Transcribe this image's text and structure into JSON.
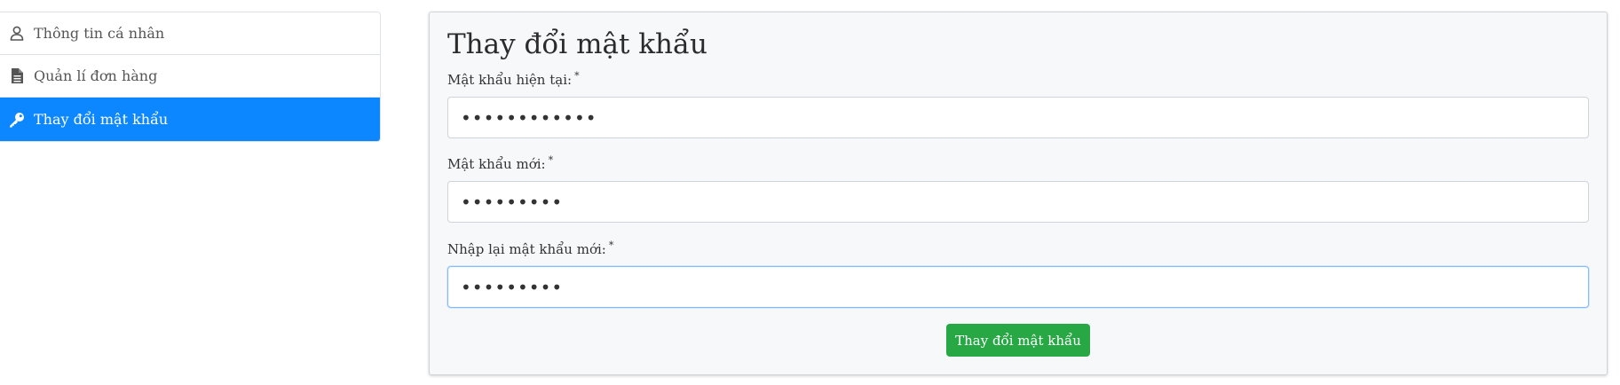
{
  "sidebar": {
    "items": [
      {
        "label": "Thông tin cá nhân",
        "icon": "user-icon"
      },
      {
        "label": "Quản lí đơn hàng",
        "icon": "file-icon"
      },
      {
        "label": "Thay đổi mật khẩu",
        "icon": "key-icon",
        "active": true
      }
    ]
  },
  "form": {
    "title": "Thay đổi mật khẩu",
    "fields": [
      {
        "label": "Mật khẩu hiện tại:",
        "required_mark": "*",
        "value": "••••••••••••"
      },
      {
        "label": "Mật khẩu mới:",
        "required_mark": "*",
        "value": "•••••••••"
      },
      {
        "label": "Nhập lại mật khẩu mới:",
        "required_mark": "*",
        "value": "•••••••••"
      }
    ],
    "submit_label": "Thay đổi mật khẩu"
  },
  "colors": {
    "active_item": "#0d87ff",
    "submit_button": "#28a745",
    "panel_bg": "#f7f8fa"
  }
}
